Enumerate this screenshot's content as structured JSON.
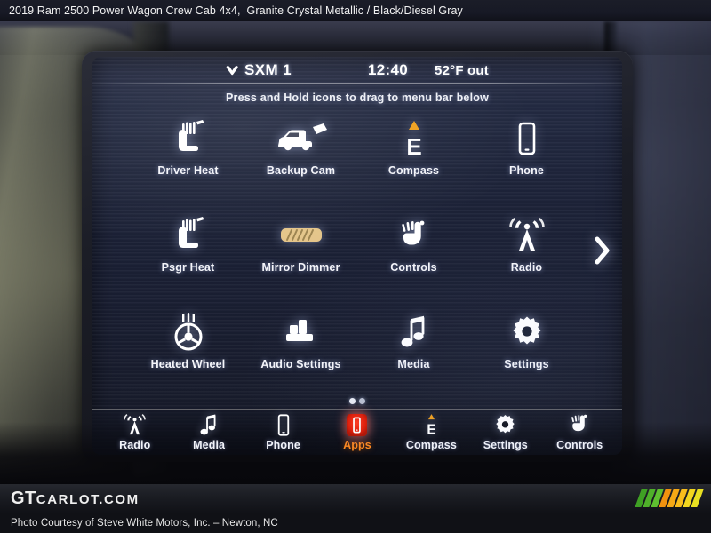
{
  "caption": {
    "vehicle": "2019 Ram 2500 Power Wagon Crew Cab 4x4,",
    "colors": "Granite Crystal Metallic / Black/Diesel Gray"
  },
  "colors": {
    "accent_orange": "#ff8a1f",
    "apps_red": "#e01d08",
    "compass_amber": "#f0a01e",
    "mirror_tan": "#e4c58a",
    "screen_text": "#f4f5fa"
  },
  "screen": {
    "status": {
      "source_icon": "sxm-logo-icon",
      "source": "SXM 1",
      "clock": "12:40",
      "temperature": "52°F out"
    },
    "hint": "Press and Hold icons to drag to menu bar below",
    "apps": [
      {
        "label": "Driver Heat",
        "icon": "seat-heat-icon"
      },
      {
        "label": "Backup Cam",
        "icon": "backup-camera-truck-icon"
      },
      {
        "label": "Compass",
        "icon": "compass-east-icon"
      },
      {
        "label": "Phone",
        "icon": "phone-icon"
      },
      {
        "label": "Psgr Heat",
        "icon": "seat-heat-icon"
      },
      {
        "label": "Mirror Dimmer",
        "icon": "rearview-mirror-icon"
      },
      {
        "label": "Controls",
        "icon": "controls-hand-icon"
      },
      {
        "label": "Radio",
        "icon": "radio-antenna-icon"
      },
      {
        "label": "Heated Wheel",
        "icon": "steering-wheel-heat-icon"
      },
      {
        "label": "Audio Settings",
        "icon": "equalizer-icon"
      },
      {
        "label": "Media",
        "icon": "music-note-icon"
      },
      {
        "label": "Settings",
        "icon": "gear-icon"
      }
    ],
    "next_page_icon": "chevron-right-icon",
    "page_count": 2,
    "current_page": 1,
    "menu": [
      {
        "label": "Radio",
        "icon": "radio-antenna-icon",
        "active": false
      },
      {
        "label": "Media",
        "icon": "music-note-icon",
        "active": false
      },
      {
        "label": "Phone",
        "icon": "phone-icon",
        "active": false
      },
      {
        "label": "Apps",
        "icon": "apps-tile-icon",
        "active": true
      },
      {
        "label": "Compass",
        "icon": "compass-east-icon",
        "active": false
      },
      {
        "label": "Settings",
        "icon": "gear-icon",
        "active": false
      },
      {
        "label": "Controls",
        "icon": "controls-hand-icon",
        "active": false
      }
    ]
  },
  "watermark": {
    "logo_gt": "GT",
    "logo_rest": "CARLOT.COM",
    "stripe_colors": [
      "#3fa024",
      "#4fb02a",
      "#5fbf30",
      "#f0920f",
      "#f5a916",
      "#f8bd1c",
      "#f2d61f",
      "#e8e022"
    ]
  },
  "credit": "Photo Courtesy of Steve White Motors, Inc. – Newton, NC"
}
